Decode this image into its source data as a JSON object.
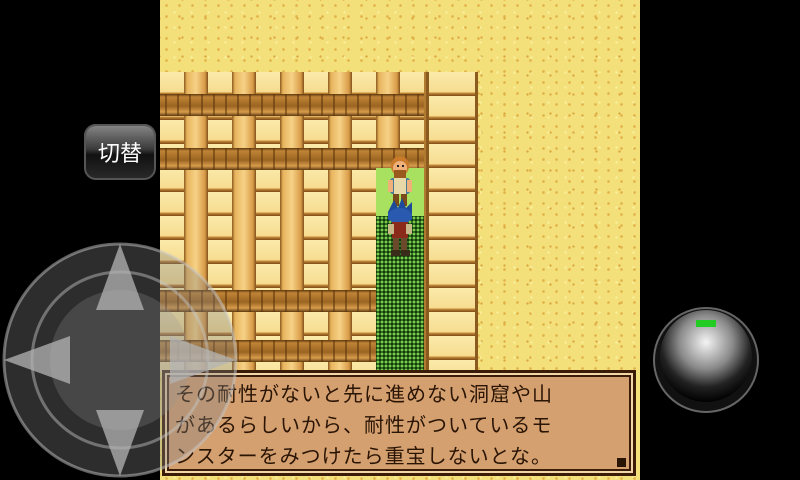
{
  "controls": {
    "toggle_label": "切替"
  },
  "dialog": {
    "lines": [
      "その耐性がないと先に進めない洞窟や山",
      "があるらしいから、耐性がついているモ",
      "ンスターをみつけたら重宝しないとな。"
    ],
    "text": "その耐性がないと先に進めない洞窟や山\nがあるらしいから、耐性がついているモ\nンスターをみつけたら重宝しないとな。"
  },
  "colors": {
    "sand": "#f4e07a",
    "dialog_bg": "#d4a070",
    "path_green": "#7ccc4a",
    "action_indicator": "#22cc22"
  },
  "icons": [
    "dpad-up-icon",
    "dpad-down-icon",
    "dpad-left-icon",
    "dpad-right-icon",
    "action-button-indicator-icon"
  ]
}
